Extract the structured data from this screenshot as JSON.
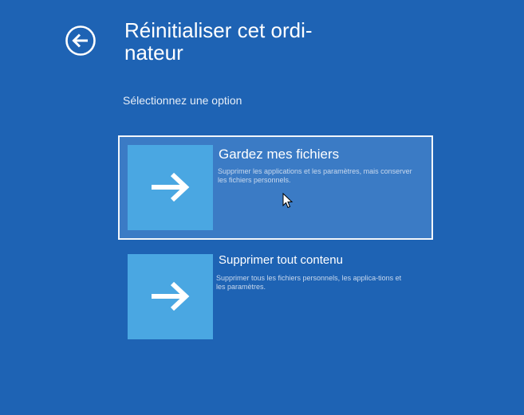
{
  "header": {
    "title": "Réinitialiser cet ordi-\nnateur",
    "back_icon": "back-arrow-circle-icon"
  },
  "subtitle": "Sélectionnez une option",
  "options": [
    {
      "title": "Gardez mes fichiers",
      "description": "Supprimer les applications et les paramètres, mais conserver les fichiers personnels.",
      "icon": "arrow-right-icon",
      "selected": true
    },
    {
      "title": "Supprimer tout contenu",
      "description": "Supprimer tous les fichiers personnels, les applica-tions et les paramètres.",
      "icon": "arrow-right-icon",
      "selected": false
    }
  ],
  "colors": {
    "background": "#1e63b4",
    "tile": "#4aa7e2",
    "selected_option": "#3b7bc5"
  }
}
